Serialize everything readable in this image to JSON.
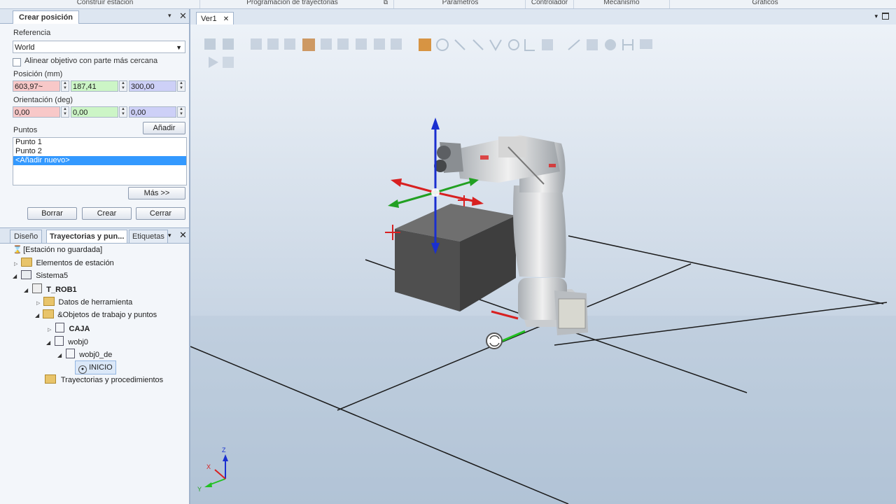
{
  "ribbon": {
    "groups": [
      "Construir estación",
      "Programación de trayectorias",
      "Parámetros",
      "Controlador",
      "Mecanismo",
      "Gráficos"
    ]
  },
  "create_position": {
    "tab_title": "Crear posición",
    "reference_label": "Referencia",
    "reference_value": "World",
    "align_checkbox_label": "Alinear objetivo con parte más cercana",
    "position_label": "Posición (mm)",
    "position": {
      "x": "603,97~",
      "y": "187,41",
      "z": "300,00"
    },
    "orientation_label": "Orientación (deg)",
    "orientation": {
      "x": "0,00",
      "y": "0,00",
      "z": "0,00"
    },
    "points_label": "Puntos",
    "add_button": "Añadir",
    "points": [
      "Punto 1",
      "Punto 2",
      "<Añadir nuevo>"
    ],
    "more_button": "Más >>",
    "delete_button": "Borrar",
    "create_button": "Crear",
    "close_button": "Cerrar"
  },
  "bottom_tabs": [
    "Diseño",
    "Trayectorias y pun...",
    "Etiquetas"
  ],
  "tree": {
    "station": "[Estación no guardada]",
    "station_elements": "Elementos de estación",
    "system": "Sistema5",
    "task": "T_ROB1",
    "tool_data": "Datos de herramienta",
    "workobjects": "&Objetos de trabajo y puntos",
    "caja": "CAJA",
    "wobj0": "wobj0",
    "wobj0_de": "wobj0_de",
    "inicio": "INICIO",
    "paths": "Trayectorias y procedimientos"
  },
  "view": {
    "tab": "Ver1"
  },
  "axes": {
    "z": "Z",
    "x": "X",
    "y": "Y"
  },
  "colors": {
    "accent": "#3399ff",
    "x_axis": "#d82020",
    "y_axis": "#20a020",
    "z_axis": "#1a2fd0"
  }
}
